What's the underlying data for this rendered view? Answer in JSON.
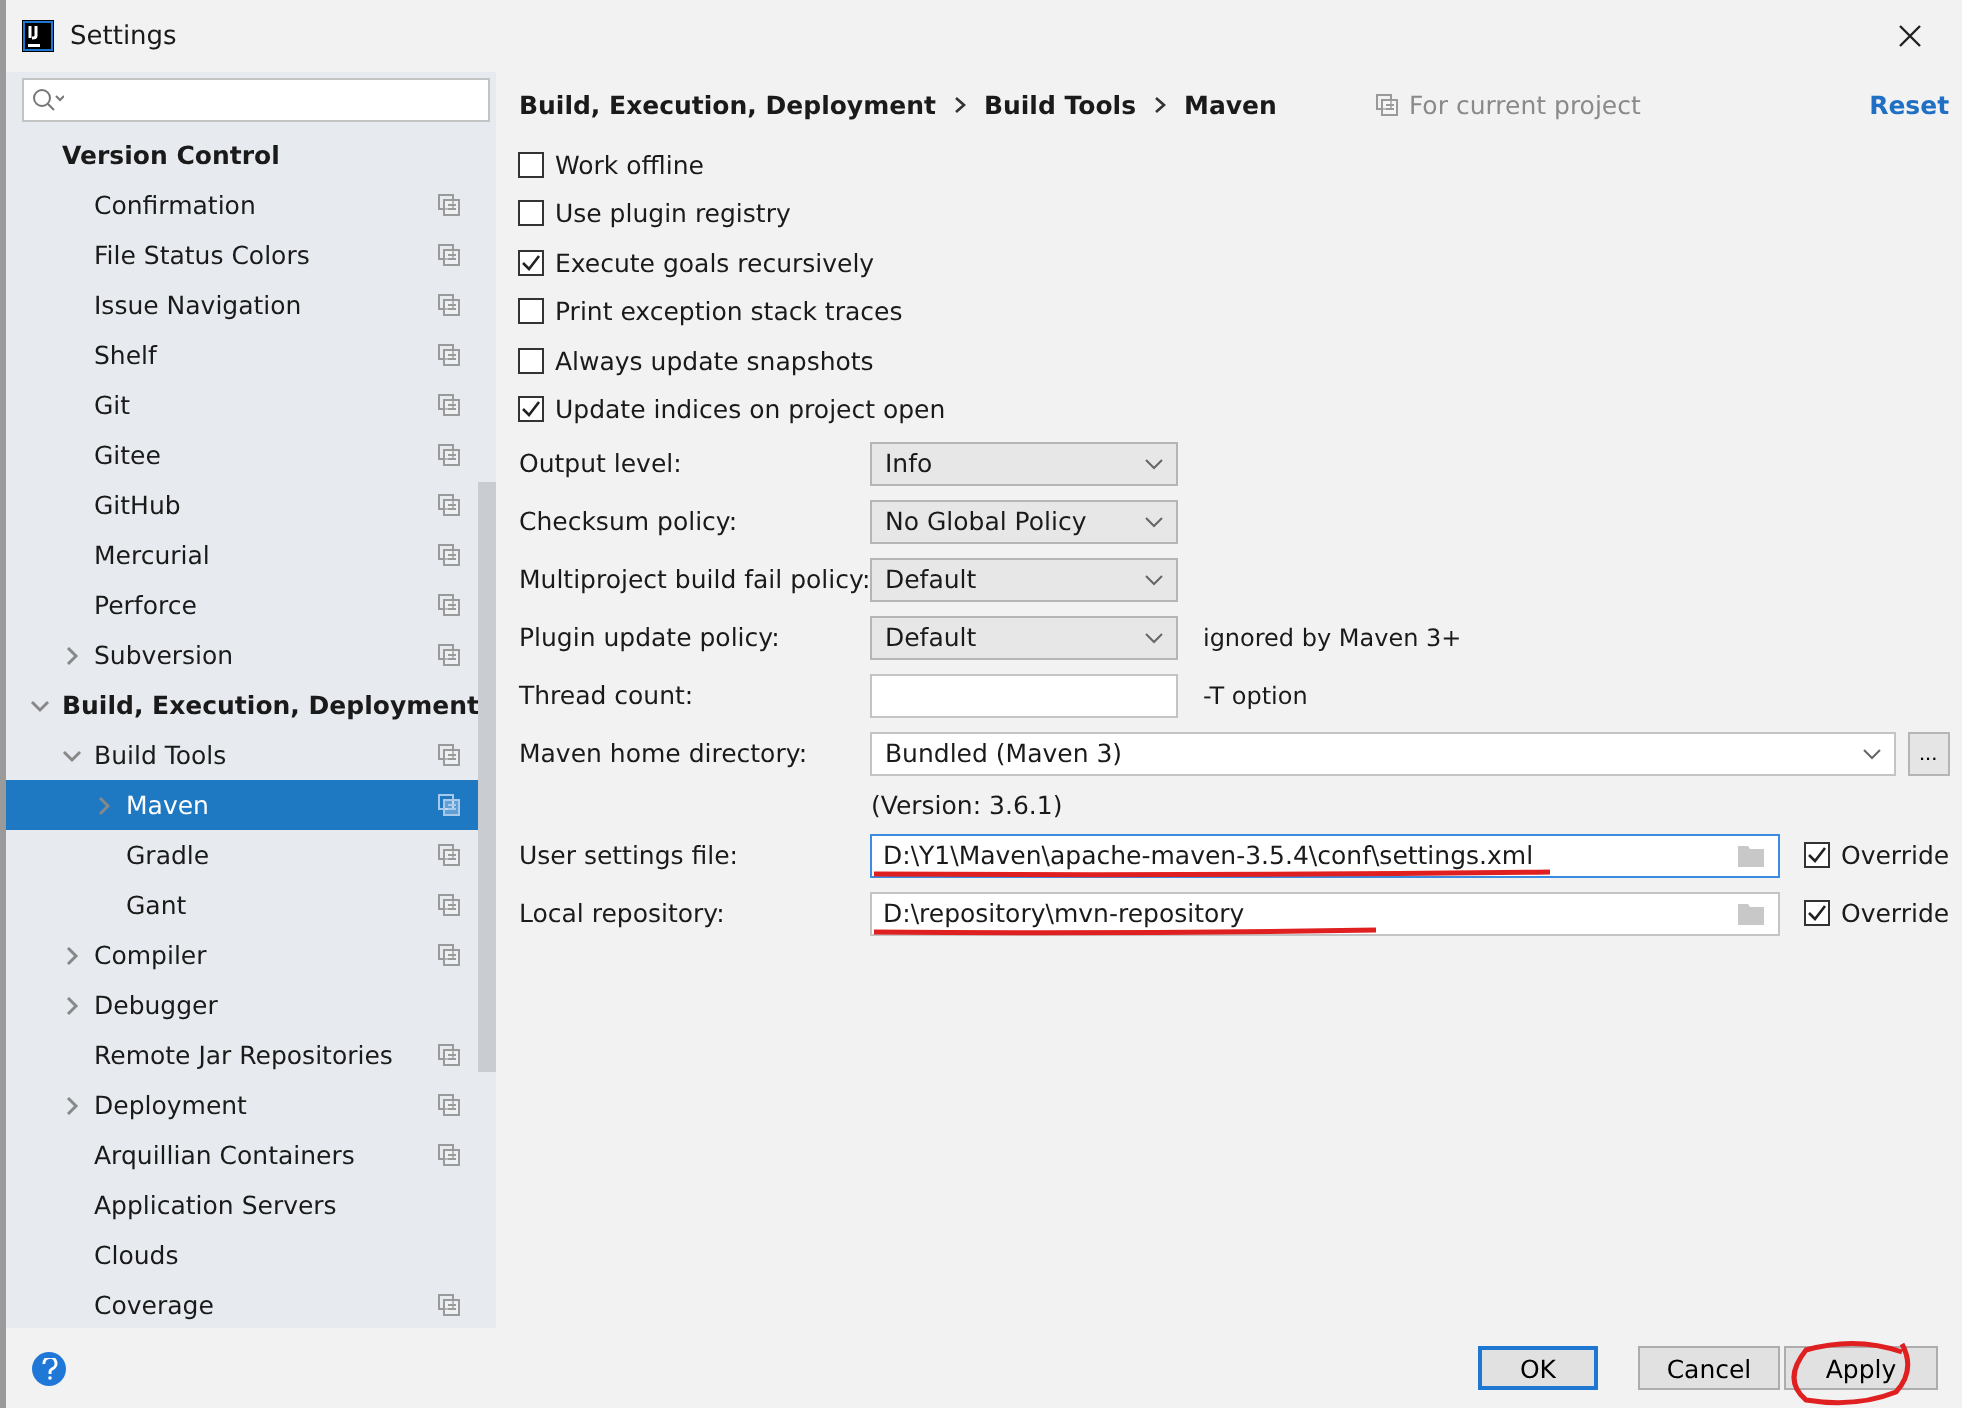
{
  "window": {
    "title": "Settings"
  },
  "sidebar": {
    "tree": [
      {
        "label": "Version Control",
        "kind": "header",
        "children": [
          {
            "label": "Confirmation",
            "project_level": true,
            "selected": false
          },
          {
            "label": "File Status Colors",
            "project_level": true,
            "selected": false
          },
          {
            "label": "Issue Navigation",
            "project_level": true,
            "selected": false
          },
          {
            "label": "Shelf",
            "project_level": true,
            "selected": false
          },
          {
            "label": "Git",
            "project_level": true,
            "selected": false
          },
          {
            "label": "Gitee",
            "project_level": true,
            "selected": false
          },
          {
            "label": "GitHub",
            "project_level": true,
            "selected": false
          },
          {
            "label": "Mercurial",
            "project_level": true,
            "selected": false
          },
          {
            "label": "Perforce",
            "project_level": true,
            "selected": false
          },
          {
            "label": "Subversion",
            "project_level": true,
            "selected": false,
            "expandable": true,
            "expanded": false
          }
        ]
      },
      {
        "label": "Build, Execution, Deployment",
        "kind": "group",
        "expandable": true,
        "expanded": true,
        "children": [
          {
            "label": "Build Tools",
            "project_level": true,
            "selected": false,
            "expandable": true,
            "expanded": true,
            "children": [
              {
                "label": "Maven",
                "project_level": true,
                "selected": true,
                "expandable": true,
                "expanded": false
              },
              {
                "label": "Gradle",
                "project_level": true,
                "selected": false
              },
              {
                "label": "Gant",
                "project_level": true,
                "selected": false
              }
            ]
          },
          {
            "label": "Compiler",
            "project_level": true,
            "selected": false,
            "expandable": true,
            "expanded": false
          },
          {
            "label": "Debugger",
            "project_level": false,
            "selected": false,
            "expandable": true,
            "expanded": false
          },
          {
            "label": "Remote Jar Repositories",
            "project_level": true,
            "selected": false
          },
          {
            "label": "Deployment",
            "project_level": true,
            "selected": false,
            "expandable": true,
            "expanded": false
          },
          {
            "label": "Arquillian Containers",
            "project_level": true,
            "selected": false
          },
          {
            "label": "Application Servers",
            "project_level": false,
            "selected": false
          },
          {
            "label": "Clouds",
            "project_level": false,
            "selected": false
          },
          {
            "label": "Coverage",
            "project_level": true,
            "selected": false
          }
        ]
      }
    ]
  },
  "breadcrumb": [
    "Build, Execution, Deployment",
    "Build Tools",
    "Maven"
  ],
  "scope_note": "For current project",
  "reset": "Reset",
  "checkboxes": [
    {
      "label": "Work offline",
      "checked": false
    },
    {
      "label": "Use plugin registry",
      "checked": false
    },
    {
      "label": "Execute goals recursively",
      "checked": true
    },
    {
      "label": "Print exception stack traces",
      "checked": false
    },
    {
      "label": "Always update snapshots",
      "checked": false
    },
    {
      "label": "Update indices on project open",
      "checked": true
    }
  ],
  "fields": [
    {
      "kind": "select",
      "label": "Output level:",
      "value": "Info"
    },
    {
      "kind": "select",
      "label": "Checksum policy:",
      "value": "No Global Policy"
    },
    {
      "kind": "select",
      "label": "Multiproject build fail policy:",
      "value": "Default"
    },
    {
      "kind": "select",
      "label": "Plugin update policy:",
      "value": "Default",
      "hint": "ignored by Maven 3+"
    },
    {
      "kind": "text",
      "label": "Thread count:",
      "hint": "-T option"
    },
    {
      "kind": "combo",
      "label": "Maven home directory:",
      "value": "Bundled (Maven 3)",
      "button": "...",
      "note": "(Version: 3.6.1)"
    },
    {
      "kind": "path",
      "label": "User settings file:",
      "value": "D:\\Y1\\Maven\\apache-maven-3.5.4\\conf\\settings.xml",
      "focused": true,
      "override": {
        "label": "Override",
        "checked": true
      }
    },
    {
      "kind": "path",
      "label": "Local repository:",
      "value": "D:\\repository\\mvn-repository",
      "focused": false,
      "override": {
        "label": "Override",
        "checked": true
      }
    }
  ],
  "buttons": [
    {
      "label": "OK",
      "default": true
    },
    {
      "label": "Cancel",
      "default": false
    },
    {
      "label": "Apply",
      "default": false
    }
  ]
}
